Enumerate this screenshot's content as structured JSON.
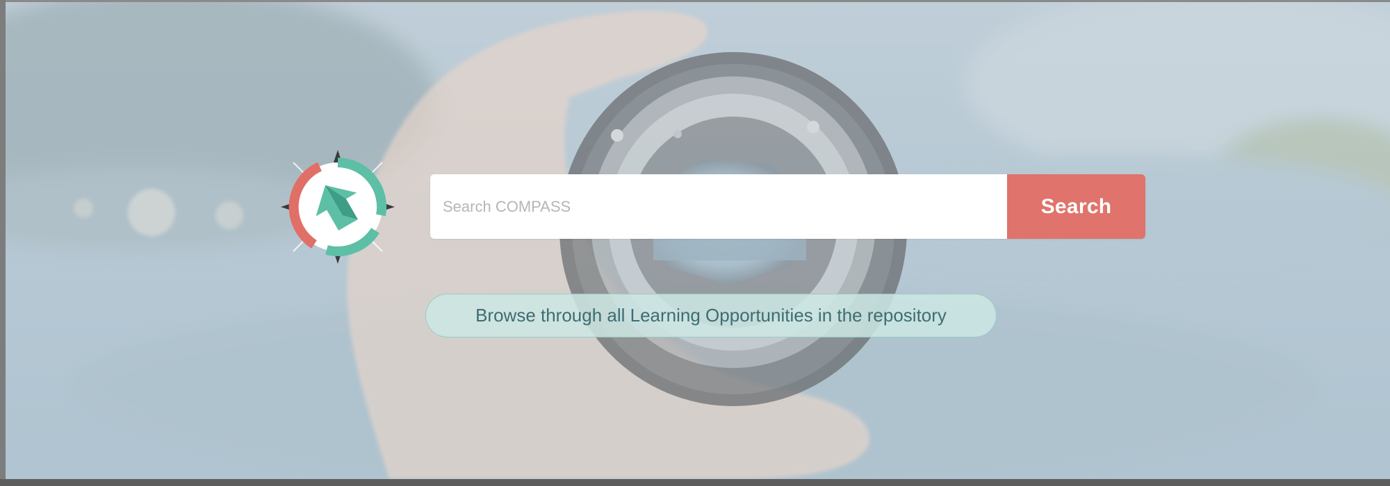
{
  "search": {
    "placeholder": "Search COMPASS",
    "button_label": "Search"
  },
  "browse": {
    "label": "Browse through all Learning Opportunities in the repository"
  },
  "logo": {
    "icon": "compass-arrow-logo",
    "colors": {
      "teal": "#5dbfa5",
      "red": "#e06f67",
      "dark": "#3a3a3a"
    }
  },
  "theme": {
    "accent": "#e0736b",
    "pill_bg": "#cce8e4",
    "pill_text": "#3d6d73"
  }
}
